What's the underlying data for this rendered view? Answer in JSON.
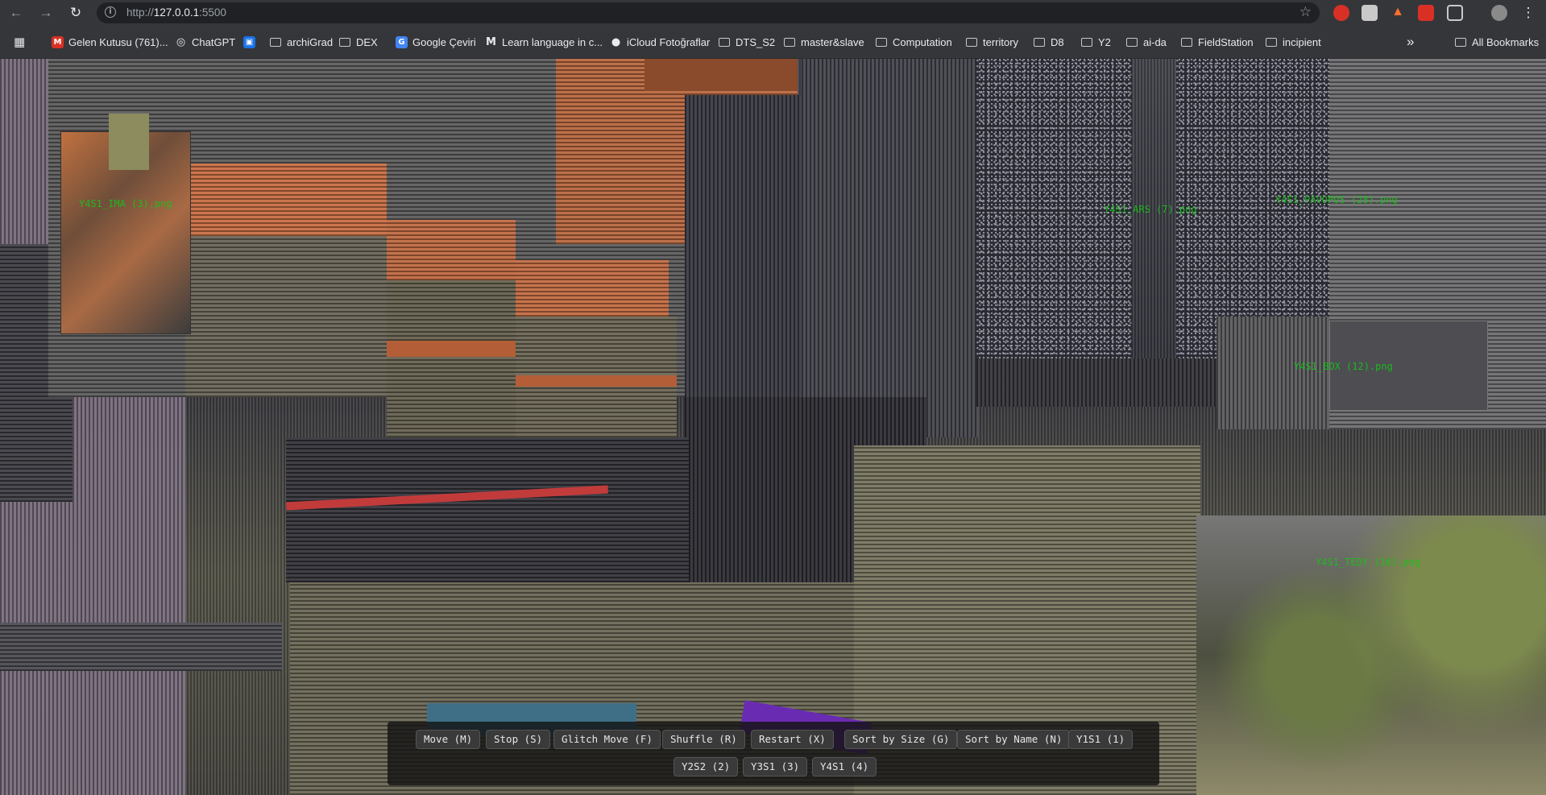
{
  "browser": {
    "url_scheme": "http://",
    "url_host": "127.0.0.1",
    "url_port": ":5500"
  },
  "bookmarks": [
    {
      "label": "Gelen Kutusu (761)...",
      "icon": "gmail-icon"
    },
    {
      "label": "ChatGPT",
      "icon": "chatgpt-icon"
    },
    {
      "label": "",
      "icon": "app-icon"
    },
    {
      "label": "archiGrad",
      "icon": "folder-icon"
    },
    {
      "label": "DEX",
      "icon": "folder-icon"
    },
    {
      "label": "Google Çeviri",
      "icon": "google-translate-icon"
    },
    {
      "label": "Learn language in c...",
      "icon": "m-icon"
    },
    {
      "label": "iCloud Fotoğraflar",
      "icon": "apple-icon"
    },
    {
      "label": "DTS_S2",
      "icon": "folder-icon"
    },
    {
      "label": "master&slave",
      "icon": "folder-icon"
    },
    {
      "label": "Computation",
      "icon": "folder-icon"
    },
    {
      "label": "territory",
      "icon": "folder-icon"
    },
    {
      "label": "D8",
      "icon": "folder-icon"
    },
    {
      "label": "Y2",
      "icon": "folder-icon"
    },
    {
      "label": "ai-da",
      "icon": "folder-icon"
    },
    {
      "label": "FieldStation",
      "icon": "folder-icon"
    },
    {
      "label": "incipient",
      "icon": "folder-icon"
    }
  ],
  "all_bookmarks": "All Bookmarks",
  "overflow": "»",
  "image_labels": [
    "Y4S1_IMA (3).png",
    "Y4S1_ARS (7).png",
    "Y4S1_PAVOPUS (28).png",
    "Y4S1_BOX (12).png",
    "Y4S1_TEDY (16).png"
  ],
  "controls": {
    "row1": [
      "Move (M)",
      "Stop (S)",
      "Glitch Move (F)",
      "Shuffle (R)",
      "Restart (X)",
      "Sort by Size (G)",
      "Sort by Name (N)",
      "Y1S1 (1)"
    ],
    "row2": [
      "Y2S2 (2)",
      "Y3S1 (3)",
      "Y4S1 (4)"
    ]
  },
  "colors": {
    "label_green": "#17c317",
    "chrome_bg": "#35363a",
    "omnibox_bg": "#202124"
  }
}
